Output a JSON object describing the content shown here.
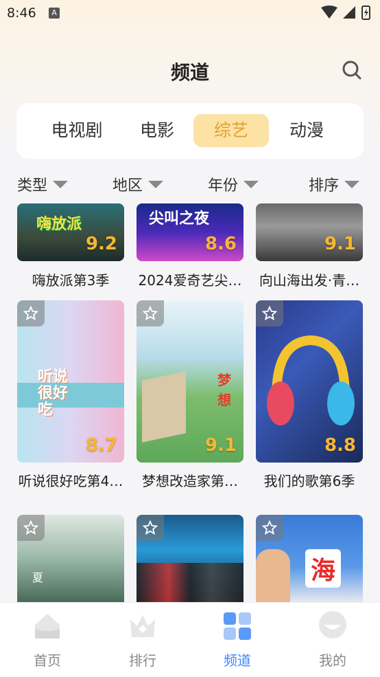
{
  "status_bar": {
    "time": "8:46",
    "notification_icon": "A"
  },
  "header": {
    "title": "频道",
    "search_icon": "search-icon"
  },
  "tabs": [
    {
      "label": "电视剧",
      "active": false
    },
    {
      "label": "电影",
      "active": false
    },
    {
      "label": "综艺",
      "active": true
    },
    {
      "label": "动漫",
      "active": false
    }
  ],
  "filters": [
    {
      "label": "类型"
    },
    {
      "label": "地区"
    },
    {
      "label": "年份"
    },
    {
      "label": "排序"
    }
  ],
  "colors": {
    "accent": "#e0a12d",
    "accent_bg": "#fde2a6",
    "score": "#f7b731",
    "nav_active": "#3f86f5"
  },
  "shows": [
    {
      "title": "嗨放派第3季",
      "score": "9.2",
      "poster_text": "嗨放派"
    },
    {
      "title": "2024爱奇艺尖…",
      "score": "8.6",
      "poster_text": "尖叫之夜"
    },
    {
      "title": "向山海出发·青…",
      "score": "9.1",
      "poster_text": ""
    },
    {
      "title": "听说很好吃第4…",
      "score": "8.7",
      "poster_text": "听说很好吃"
    },
    {
      "title": "梦想改造家第…",
      "score": "9.1",
      "poster_text": "梦想"
    },
    {
      "title": "我们的歌第6季",
      "score": "8.8",
      "poster_text": ""
    },
    {
      "title": "",
      "score": "",
      "poster_text": "夏"
    },
    {
      "title": "",
      "score": "",
      "poster_text": ""
    },
    {
      "title": "",
      "score": "",
      "poster_text": "海"
    }
  ],
  "bottom_nav": [
    {
      "label": "首页",
      "icon": "home-icon",
      "active": false
    },
    {
      "label": "排行",
      "icon": "crown-icon",
      "active": false
    },
    {
      "label": "频道",
      "icon": "grid-icon",
      "active": true
    },
    {
      "label": "我的",
      "icon": "profile-icon",
      "active": false
    }
  ]
}
